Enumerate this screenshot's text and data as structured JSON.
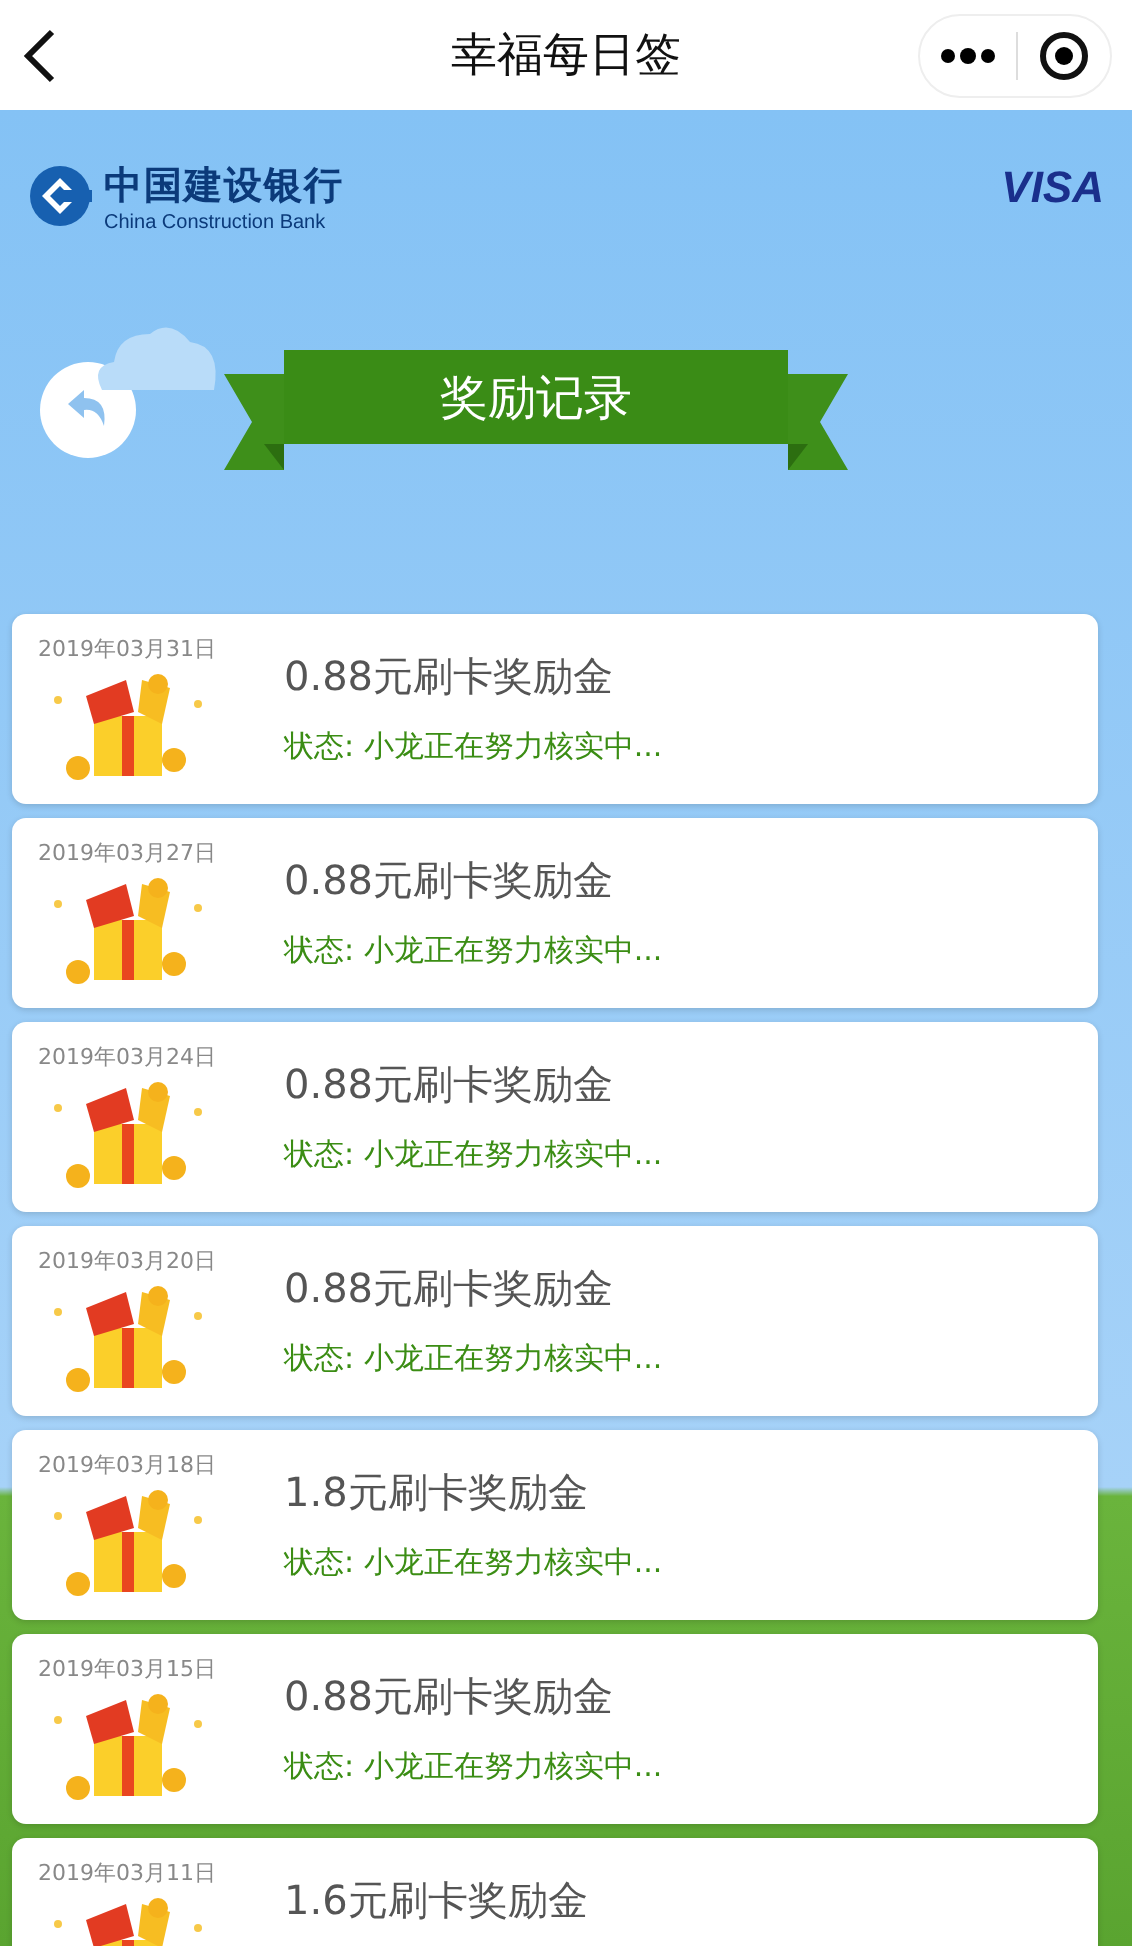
{
  "nav_bar": {
    "title": "幸福每日签"
  },
  "bank_logo": {
    "name": "中国建设银行",
    "name_en": "China Construction Bank"
  },
  "card_brand": "VISA",
  "banner": {
    "title": "奖励记录"
  },
  "records": [
    {
      "date": "2019年03月31日",
      "title": "0.88元刷卡奖励金",
      "status": "状态: 小龙正在努力核实中..."
    },
    {
      "date": "2019年03月27日",
      "title": "0.88元刷卡奖励金",
      "status": "状态: 小龙正在努力核实中..."
    },
    {
      "date": "2019年03月24日",
      "title": "0.88元刷卡奖励金",
      "status": "状态: 小龙正在努力核实中..."
    },
    {
      "date": "2019年03月20日",
      "title": "0.88元刷卡奖励金",
      "status": "状态: 小龙正在努力核实中..."
    },
    {
      "date": "2019年03月18日",
      "title": "1.8元刷卡奖励金",
      "status": "状态: 小龙正在努力核实中..."
    },
    {
      "date": "2019年03月15日",
      "title": "0.88元刷卡奖励金",
      "status": "状态: 小龙正在努力核实中..."
    },
    {
      "date": "2019年03月11日",
      "title": "1.6元刷卡奖励金"
    }
  ]
}
